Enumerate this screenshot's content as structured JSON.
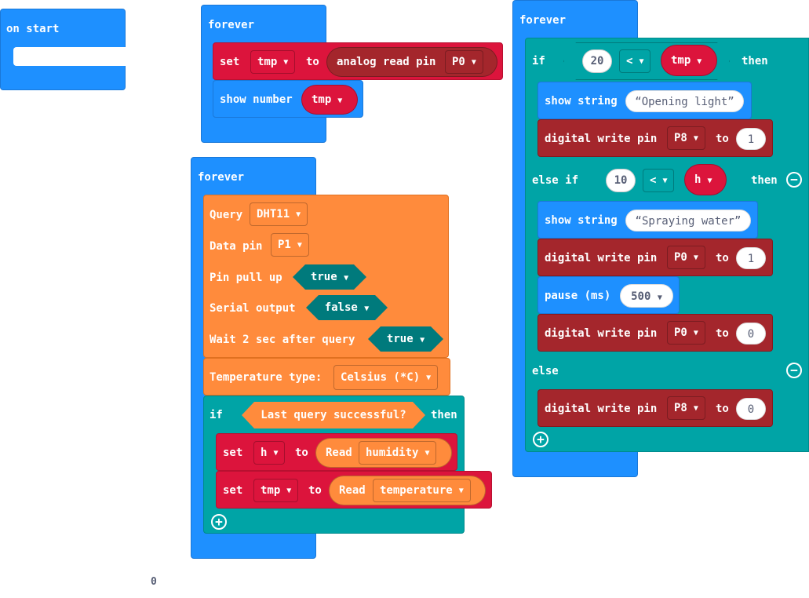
{
  "on_start": {
    "label": "on start"
  },
  "forever1": {
    "label": "forever",
    "set_kw": "set",
    "set_var": "tmp",
    "to_kw": "to",
    "analog_label": "analog read pin",
    "analog_pin": "P0",
    "show_number_label": "show number",
    "show_number_var": "tmp"
  },
  "forever2": {
    "label": "forever",
    "query_label": "Query",
    "query_sensor": "DHT11",
    "data_pin_label": "Data pin",
    "data_pin": "P1",
    "pin_pull_up_label": "Pin pull up",
    "pin_pull_up_value": "true",
    "serial_output_label": "Serial output",
    "serial_output_value": "false",
    "wait_label": "Wait 2 sec after query",
    "wait_value": "true",
    "temp_type_label": "Temperature type:",
    "temp_type_value": "Celsius (*C)",
    "if_kw": "if",
    "condition": "Last query successful?",
    "then_kw": "then",
    "set_h_kw": "set",
    "set_h_var": "h",
    "set_h_to": "to",
    "set_h_read": "Read",
    "set_h_field": "humidity",
    "set_tmp_kw": "set",
    "set_tmp_var": "tmp",
    "set_tmp_to": "to",
    "set_tmp_read": "Read",
    "set_tmp_field": "temperature"
  },
  "forever3": {
    "label": "forever",
    "if_kw": "if",
    "if_left": "20",
    "if_op": "<",
    "if_var": "tmp",
    "then_kw": "then",
    "show_string1_label": "show string",
    "show_string1_value": "Opening light",
    "dw1_label": "digital write pin",
    "dw1_pin": "P8",
    "dw1_to": "to",
    "dw1_value": "1",
    "else_if_kw": "else if",
    "elif_left": "10",
    "elif_op": "<",
    "elif_var": "h",
    "elif_then": "then",
    "show_string2_label": "show string",
    "show_string2_value": "Spraying water",
    "dw2_label": "digital write pin",
    "dw2_pin": "P0",
    "dw2_to": "to",
    "dw2_value": "1",
    "pause_label": "pause (ms)",
    "pause_value": "500",
    "dw3_label": "digital write pin",
    "dw3_pin": "P0",
    "dw3_to": "to",
    "dw3_value": "0",
    "else_kw": "else",
    "dw4_label": "digital write pin",
    "dw4_pin": "P8",
    "dw4_to": "to",
    "dw4_value": "0"
  },
  "canvas_counter": "0",
  "icons": {
    "dropdown": "triangle-down",
    "add": "plus-circle",
    "remove": "minus-circle"
  },
  "colors": {
    "basic_blue": "#1e90ff",
    "variables_red": "#dc143c",
    "pins_darkred": "#a4262c",
    "dht_orange": "#ff8b3c",
    "logic_teal": "#00a4a6"
  }
}
